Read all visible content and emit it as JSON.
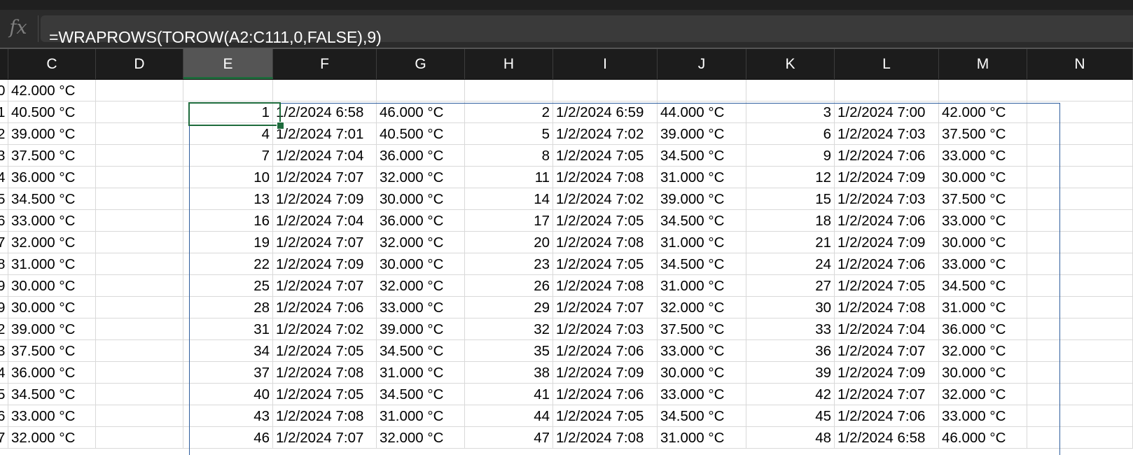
{
  "formula_bar": {
    "fx_label": "fx",
    "formula": "=WRAPROWS(TOROW(A2:C111,0,FALSE),9)"
  },
  "columns": [
    "C",
    "D",
    "E",
    "F",
    "G",
    "H",
    "I",
    "J",
    "K",
    "L",
    "M",
    "N"
  ],
  "selected_column": "E",
  "active_cell": "E2",
  "left_column": {
    "row_stubs": [
      "0",
      "1",
      "2",
      "3",
      "4",
      "5",
      "6",
      "7",
      "8",
      "9",
      "9",
      "2",
      "3",
      "4",
      "5",
      "6",
      "7"
    ],
    "values": [
      "42.000 °C",
      "40.500 °C",
      "39.000 °C",
      "37.500 °C",
      "36.000 °C",
      "34.500 °C",
      "33.000 °C",
      "32.000 °C",
      "31.000 °C",
      "30.000 °C",
      "30.000 °C",
      "39.000 °C",
      "37.500 °C",
      "36.000 °C",
      "34.500 °C",
      "33.000 °C",
      "32.000 °C"
    ]
  },
  "result_rows": [
    [
      "1",
      "1/2/2024 6:58",
      "46.000 °C",
      "2",
      "1/2/2024 6:59",
      "44.000 °C",
      "3",
      "1/2/2024 7:00",
      "42.000 °C"
    ],
    [
      "4",
      "1/2/2024 7:01",
      "40.500 °C",
      "5",
      "1/2/2024 7:02",
      "39.000 °C",
      "6",
      "1/2/2024 7:03",
      "37.500 °C"
    ],
    [
      "7",
      "1/2/2024 7:04",
      "36.000 °C",
      "8",
      "1/2/2024 7:05",
      "34.500 °C",
      "9",
      "1/2/2024 7:06",
      "33.000 °C"
    ],
    [
      "10",
      "1/2/2024 7:07",
      "32.000 °C",
      "11",
      "1/2/2024 7:08",
      "31.000 °C",
      "12",
      "1/2/2024 7:09",
      "30.000 °C"
    ],
    [
      "13",
      "1/2/2024 7:09",
      "30.000 °C",
      "14",
      "1/2/2024 7:02",
      "39.000 °C",
      "15",
      "1/2/2024 7:03",
      "37.500 °C"
    ],
    [
      "16",
      "1/2/2024 7:04",
      "36.000 °C",
      "17",
      "1/2/2024 7:05",
      "34.500 °C",
      "18",
      "1/2/2024 7:06",
      "33.000 °C"
    ],
    [
      "19",
      "1/2/2024 7:07",
      "32.000 °C",
      "20",
      "1/2/2024 7:08",
      "31.000 °C",
      "21",
      "1/2/2024 7:09",
      "30.000 °C"
    ],
    [
      "22",
      "1/2/2024 7:09",
      "30.000 °C",
      "23",
      "1/2/2024 7:05",
      "34.500 °C",
      "24",
      "1/2/2024 7:06",
      "33.000 °C"
    ],
    [
      "25",
      "1/2/2024 7:07",
      "32.000 °C",
      "26",
      "1/2/2024 7:08",
      "31.000 °C",
      "27",
      "1/2/2024 7:05",
      "34.500 °C"
    ],
    [
      "28",
      "1/2/2024 7:06",
      "33.000 °C",
      "29",
      "1/2/2024 7:07",
      "32.000 °C",
      "30",
      "1/2/2024 7:08",
      "31.000 °C"
    ],
    [
      "31",
      "1/2/2024 7:02",
      "39.000 °C",
      "32",
      "1/2/2024 7:03",
      "37.500 °C",
      "33",
      "1/2/2024 7:04",
      "36.000 °C"
    ],
    [
      "34",
      "1/2/2024 7:05",
      "34.500 °C",
      "35",
      "1/2/2024 7:06",
      "33.000 °C",
      "36",
      "1/2/2024 7:07",
      "32.000 °C"
    ],
    [
      "37",
      "1/2/2024 7:08",
      "31.000 °C",
      "38",
      "1/2/2024 7:09",
      "30.000 °C",
      "39",
      "1/2/2024 7:09",
      "30.000 °C"
    ],
    [
      "40",
      "1/2/2024 7:05",
      "34.500 °C",
      "41",
      "1/2/2024 7:06",
      "33.000 °C",
      "42",
      "1/2/2024 7:07",
      "32.000 °C"
    ],
    [
      "43",
      "1/2/2024 7:08",
      "31.000 °C",
      "44",
      "1/2/2024 7:05",
      "34.500 °C",
      "45",
      "1/2/2024 7:06",
      "33.000 °C"
    ],
    [
      "46",
      "1/2/2024 7:07",
      "32.000 °C",
      "47",
      "1/2/2024 7:08",
      "31.000 °C",
      "48",
      "1/2/2024 6:58",
      "46.000 °C"
    ]
  ],
  "colors": {
    "header_bg": "#1c1c1c",
    "formula_bg": "#2b2b2b",
    "active_cell_border": "#1e6b3c",
    "spill_border": "#2f5e9e",
    "gridline": "#d9d9d9"
  }
}
